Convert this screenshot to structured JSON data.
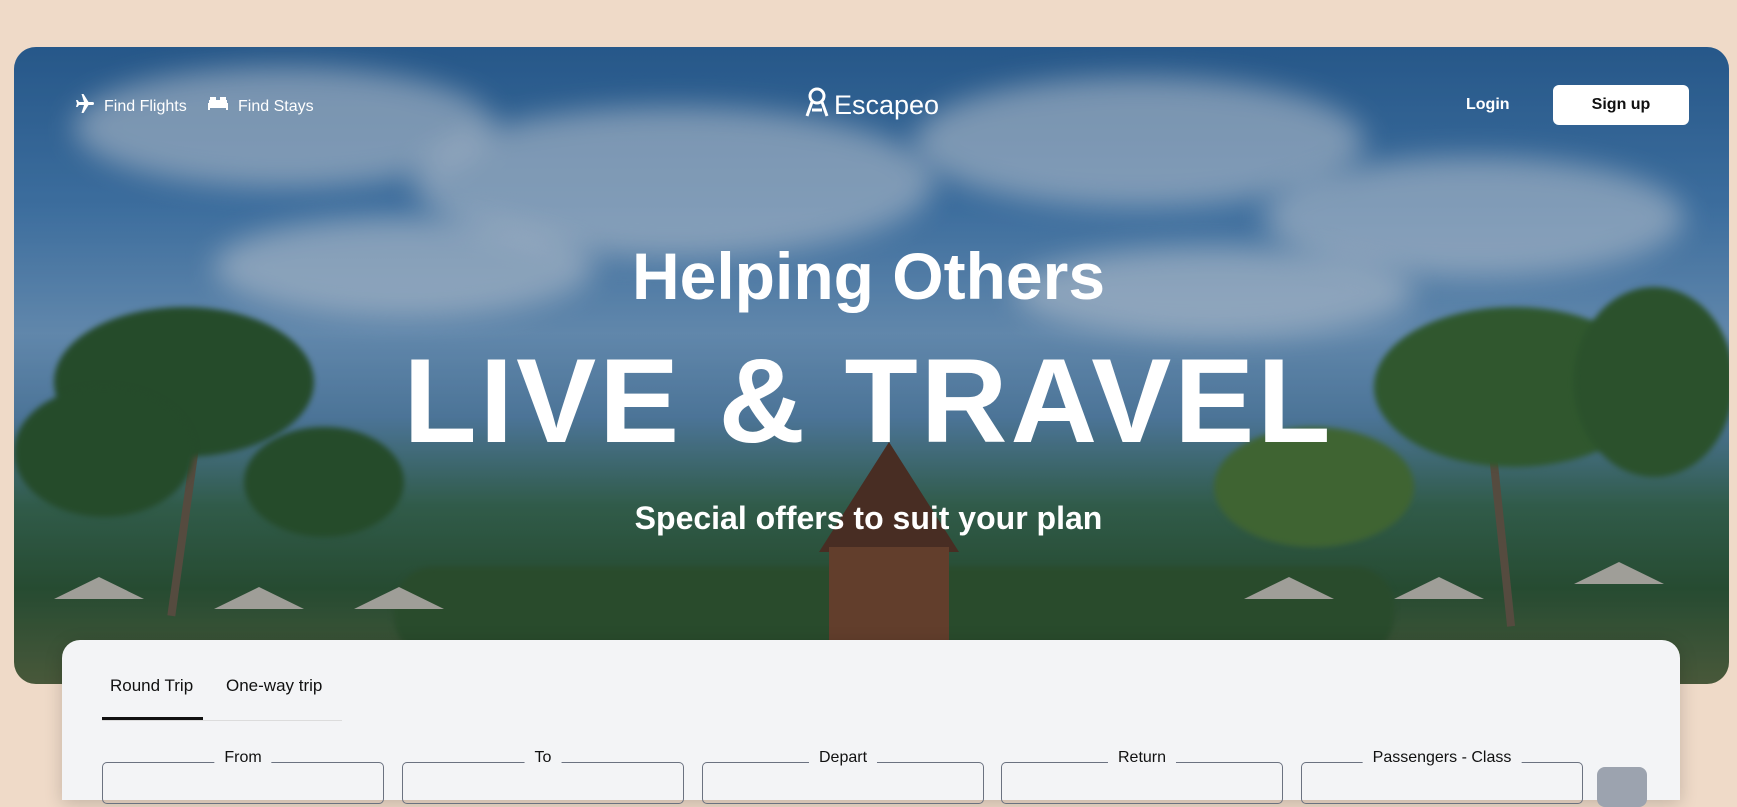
{
  "nav": {
    "find_flights": "Find Flights",
    "find_stays": "Find Stays",
    "logo": "Escapeo",
    "login": "Login",
    "signup": "Sign up"
  },
  "hero": {
    "line1": "Helping Others",
    "line2": "LIVE & TRAVEL",
    "line3": "Special offers to suit your plan"
  },
  "search": {
    "tabs": [
      "Round Trip",
      "One-way trip"
    ],
    "active_tab": "Round Trip",
    "fields": [
      "From",
      "To",
      "Depart",
      "Return",
      "Passengers - Class"
    ]
  },
  "icons": {
    "flights": "airplane-icon",
    "stays": "bed-icon",
    "logo": "location-pin-icon"
  },
  "colors": {
    "page_bg": "#efdac8",
    "panel_bg": "#f3f4f6",
    "accent": "#111111"
  }
}
